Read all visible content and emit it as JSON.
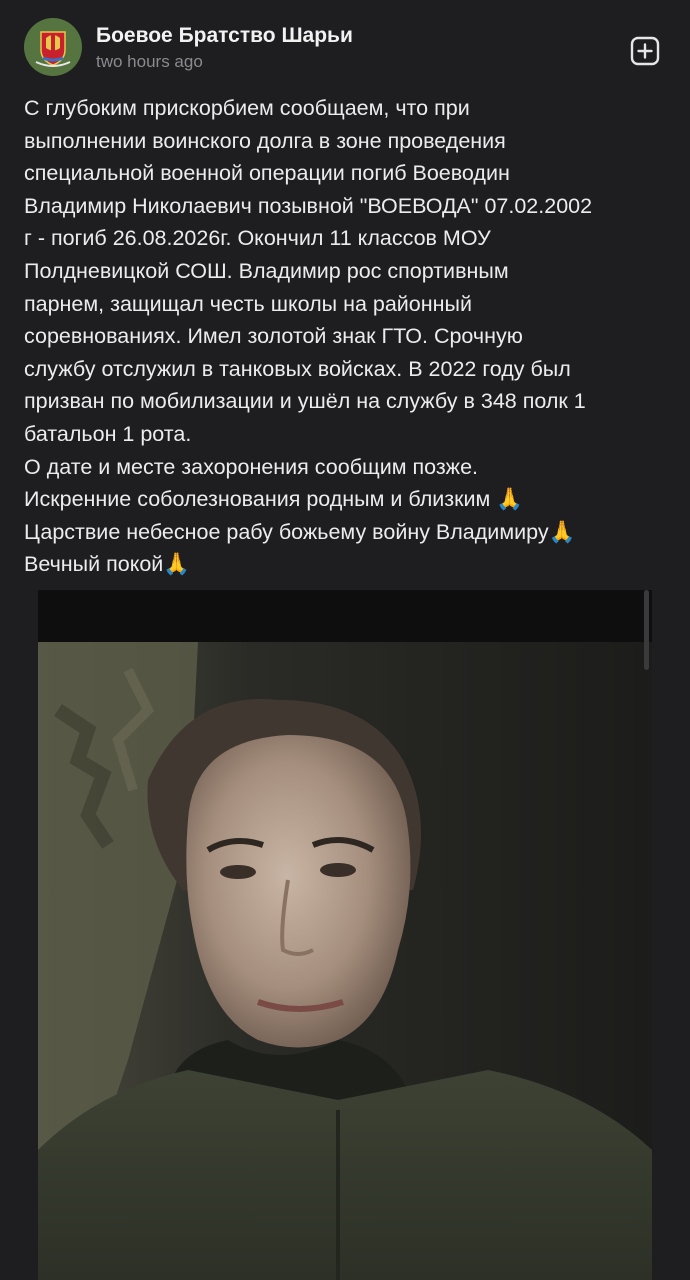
{
  "post": {
    "author": "Боевое Братство Шарьи",
    "timestamp": "two hours ago",
    "text_lines": [
      "С глубоким прискорбием сообщаем, что при",
      "выполнении воинского долга в зоне проведения",
      "специальной военной операции погиб Воеводин",
      "Владимир Николаевич позывной \"ВОЕВОДА\" 07.02.2002",
      "г - погиб 26.08.2026г. Окончил 11 классов МОУ",
      "Полдневицкой СОШ. Владимир рос спортивным",
      "парнем, защищал честь школы на районный",
      "соревнованиях. Имел золотой знак ГТО. Срочную",
      "службу отслужил в танковых войсках. В 2022 году был",
      "призван по мобилизации и ушёл на службу в 348 полк 1",
      "батальон 1 рота.",
      "О дате и месте захоронения сообщим позже.",
      "Искренние соболезнования родным и близким 🙏",
      "Царствие небесное рабу божьему войну Владимиру🙏",
      "Вечный покой🙏"
    ]
  },
  "icons": {
    "avatar": "coat-of-arms-icon",
    "add": "plus-square-icon"
  },
  "colors": {
    "background": "#1e1e20",
    "text": "#ececee",
    "muted": "#8a8a8f"
  }
}
